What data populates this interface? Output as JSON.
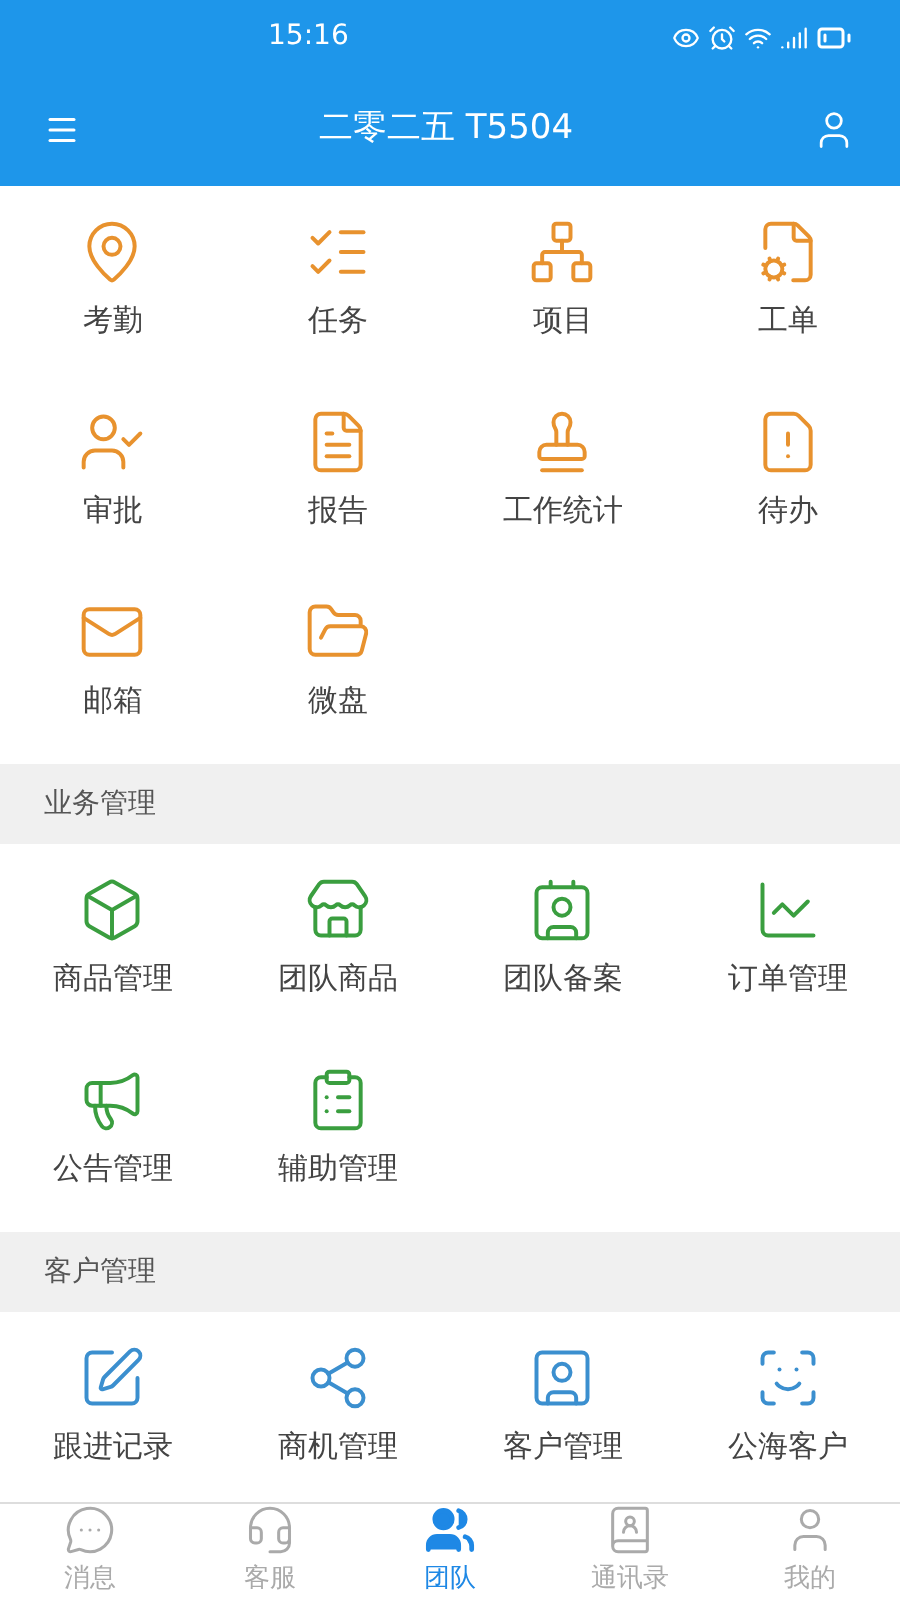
{
  "status_bar": {
    "time": "15:16"
  },
  "app_bar": {
    "title": "二零二五 T5504"
  },
  "sections": [
    {
      "color": "#e8922e",
      "items": [
        {
          "label": "考勤"
        },
        {
          "label": "任务"
        },
        {
          "label": "项目"
        },
        {
          "label": "工单"
        },
        {
          "label": "审批"
        },
        {
          "label": "报告"
        },
        {
          "label": "工作统计"
        },
        {
          "label": "待办"
        },
        {
          "label": "邮箱"
        },
        {
          "label": "微盘"
        }
      ]
    },
    {
      "header": "业务管理",
      "color": "#3a9e3f",
      "items": [
        {
          "label": "商品管理"
        },
        {
          "label": "团队商品"
        },
        {
          "label": "团队备案"
        },
        {
          "label": "订单管理"
        },
        {
          "label": "公告管理"
        },
        {
          "label": "辅助管理"
        }
      ]
    },
    {
      "header": "客户管理",
      "color": "#3b8fcf",
      "items": [
        {
          "label": "跟进记录"
        },
        {
          "label": "商机管理"
        },
        {
          "label": "客户管理"
        },
        {
          "label": "公海客户"
        }
      ]
    }
  ],
  "tab_bar": [
    {
      "label": "消息",
      "selected": false
    },
    {
      "label": "客服",
      "selected": false
    },
    {
      "label": "团队",
      "selected": true
    },
    {
      "label": "通讯录",
      "selected": false
    },
    {
      "label": "我的",
      "selected": false
    }
  ]
}
